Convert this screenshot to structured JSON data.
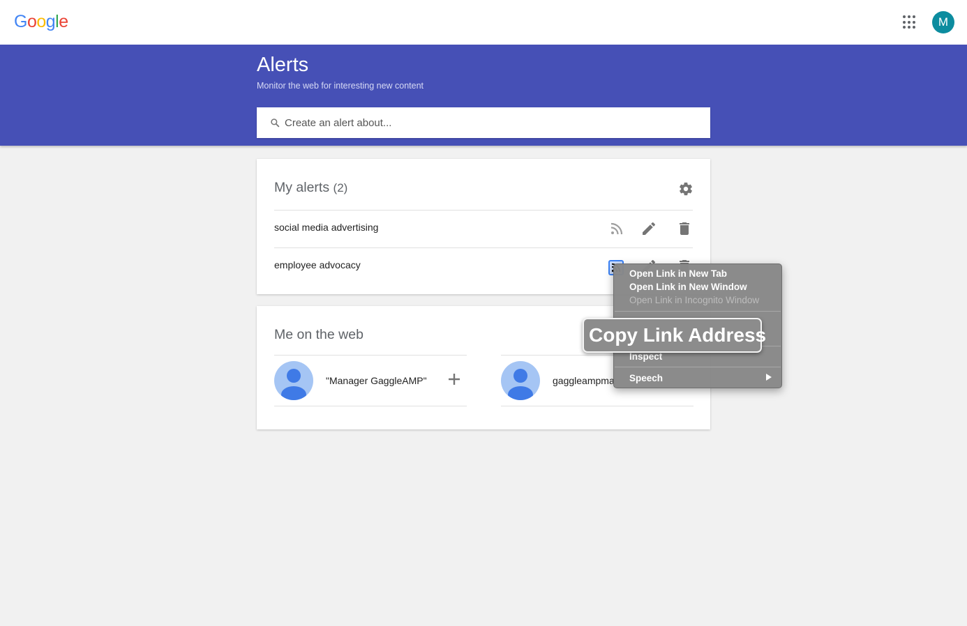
{
  "header": {
    "logo_letters": [
      {
        "ch": "G",
        "color": "#4285F4"
      },
      {
        "ch": "o",
        "color": "#EA4335"
      },
      {
        "ch": "o",
        "color": "#FBBC05"
      },
      {
        "ch": "g",
        "color": "#4285F4"
      },
      {
        "ch": "l",
        "color": "#34A853"
      },
      {
        "ch": "e",
        "color": "#EA4335"
      }
    ],
    "avatar_letter": "M",
    "avatar_color": "#0c8c9f",
    "apps_icon": "apps-grid-icon"
  },
  "banner": {
    "title": "Alerts",
    "subtitle": "Monitor the web for interesting new content",
    "search_placeholder": "Create an alert about...",
    "color": "#4650b6"
  },
  "my_alerts": {
    "title": "My alerts",
    "count": "(2)",
    "items": [
      {
        "label": "social media advertising"
      },
      {
        "label": "employee advocacy"
      }
    ]
  },
  "me_on_web": {
    "title": "Me on the web",
    "people": [
      {
        "name": "\"Manager GaggleAMP\""
      },
      {
        "name": "gaggleampma"
      }
    ]
  },
  "context_menu": {
    "items": [
      {
        "label": "Open Link in New Tab",
        "disabled": false
      },
      {
        "label": "Open Link in New Window",
        "disabled": false
      },
      {
        "label": "Open Link in Incognito Window",
        "disabled": true
      },
      {
        "label": "Inspect",
        "disabled": false
      },
      {
        "label": "Speech",
        "disabled": false
      }
    ],
    "zoom_label": "Copy Link Address"
  }
}
